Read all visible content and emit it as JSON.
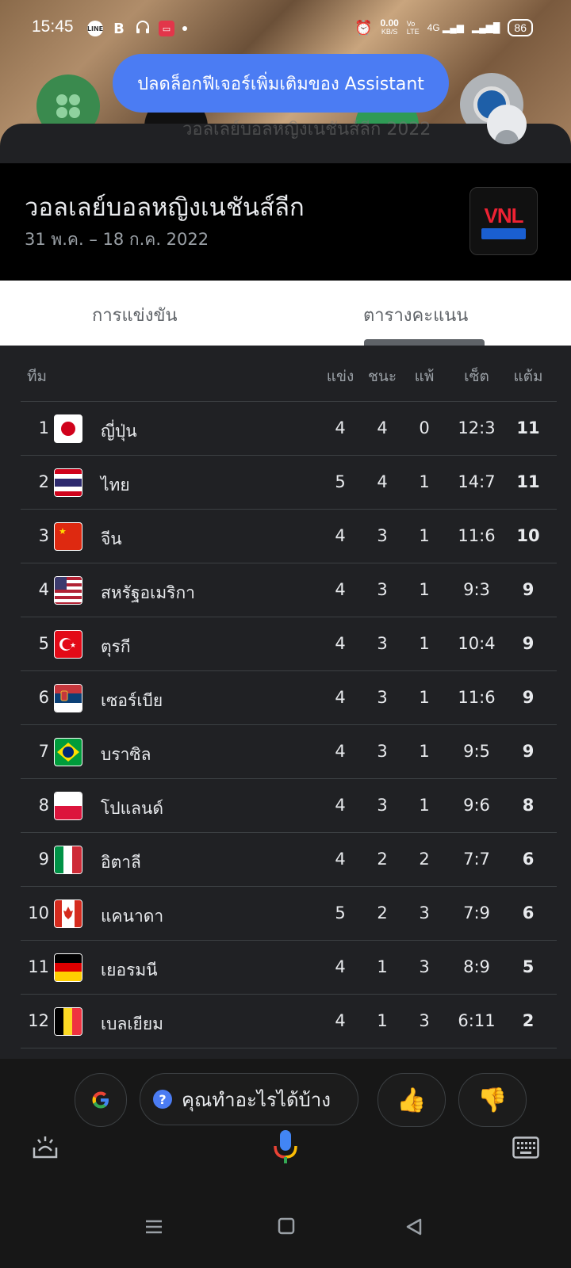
{
  "status_bar": {
    "time": "15:45",
    "net_speed": "0.00",
    "net_unit": "KB/S",
    "battery": "86"
  },
  "toast": {
    "text": "ปลดล็อกฟีเจอร์เพิ่มเติมของ Assistant"
  },
  "ghost_title": "วอลเลย์บอลหญิงเนชันส์ลีก 2022",
  "header": {
    "title": "วอลเลย์บอลหญิงเนชันส์ลีก",
    "dates": "31 พ.ค. – 18 ก.ค. 2022",
    "logo_text": "VNL"
  },
  "tabs": [
    {
      "label": "การแข่งขัน"
    },
    {
      "label": "ตารางคะแนน"
    }
  ],
  "table": {
    "headers": {
      "team": "ทีม",
      "played": "แข่ง",
      "won": "ชนะ",
      "lost": "แพ้",
      "sets": "เซ็ต",
      "points": "แต้ม"
    },
    "rows": [
      {
        "rank": "1",
        "team": "ญี่ปุ่น",
        "played": "4",
        "won": "4",
        "lost": "0",
        "sets": "12:3",
        "points": "11"
      },
      {
        "rank": "2",
        "team": "ไทย",
        "played": "5",
        "won": "4",
        "lost": "1",
        "sets": "14:7",
        "points": "11"
      },
      {
        "rank": "3",
        "team": "จีน",
        "played": "4",
        "won": "3",
        "lost": "1",
        "sets": "11:6",
        "points": "10"
      },
      {
        "rank": "4",
        "team": "สหรัฐอเมริกา",
        "played": "4",
        "won": "3",
        "lost": "1",
        "sets": "9:3",
        "points": "9"
      },
      {
        "rank": "5",
        "team": "ตุรกี",
        "played": "4",
        "won": "3",
        "lost": "1",
        "sets": "10:4",
        "points": "9"
      },
      {
        "rank": "6",
        "team": "เซอร์เบีย",
        "played": "4",
        "won": "3",
        "lost": "1",
        "sets": "11:6",
        "points": "9"
      },
      {
        "rank": "7",
        "team": "บราซิล",
        "played": "4",
        "won": "3",
        "lost": "1",
        "sets": "9:5",
        "points": "9"
      },
      {
        "rank": "8",
        "team": "โปแลนด์",
        "played": "4",
        "won": "3",
        "lost": "1",
        "sets": "9:6",
        "points": "8"
      },
      {
        "rank": "9",
        "team": "อิตาลี",
        "played": "4",
        "won": "2",
        "lost": "2",
        "sets": "7:7",
        "points": "6"
      },
      {
        "rank": "10",
        "team": "แคนาดา",
        "played": "5",
        "won": "2",
        "lost": "3",
        "sets": "7:9",
        "points": "6"
      },
      {
        "rank": "11",
        "team": "เยอรมนี",
        "played": "4",
        "won": "1",
        "lost": "3",
        "sets": "8:9",
        "points": "5"
      },
      {
        "rank": "12",
        "team": "เบลเยียม",
        "played": "4",
        "won": "1",
        "lost": "3",
        "sets": "6:11",
        "points": "2"
      }
    ]
  },
  "suggestions": {
    "query": "คุณทำอะไรได้บ้าง"
  },
  "colors": {
    "accent": "#4b7cf3",
    "background": "#202124",
    "header_bg": "#000000"
  }
}
